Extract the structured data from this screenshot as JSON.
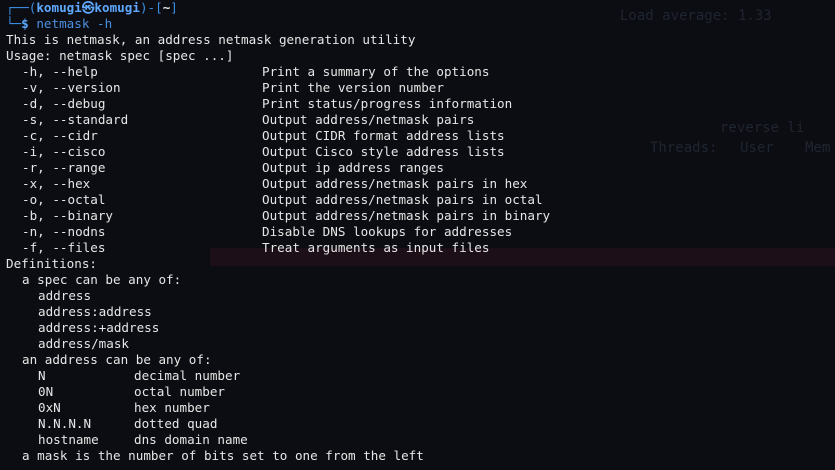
{
  "prompt": {
    "corner_top": "┌──(",
    "user": "komugi㉿komugi",
    "mid": ")-[",
    "dir": "~",
    "end": "]",
    "corner_bottom": "└─",
    "dollar": "$",
    "command": " netmask -h"
  },
  "intro": "This is netmask, an address netmask generation utility",
  "usage": "Usage: netmask spec [spec ...]",
  "options": [
    {
      "flag": "-h, --help",
      "desc": "Print a summary of the options"
    },
    {
      "flag": "-v, --version",
      "desc": "Print the version number"
    },
    {
      "flag": "-d, --debug",
      "desc": "Print status/progress information"
    },
    {
      "flag": "-s, --standard",
      "desc": "Output address/netmask pairs"
    },
    {
      "flag": "-c, --cidr",
      "desc": "Output CIDR format address lists"
    },
    {
      "flag": "-i, --cisco",
      "desc": "Output Cisco style address lists"
    },
    {
      "flag": "-r, --range",
      "desc": "Output ip address ranges"
    },
    {
      "flag": "-x, --hex",
      "desc": "Output address/netmask pairs in hex"
    },
    {
      "flag": "-o, --octal",
      "desc": "Output address/netmask pairs in octal"
    },
    {
      "flag": "-b, --binary",
      "desc": "Output address/netmask pairs in binary"
    },
    {
      "flag": "-n, --nodns",
      "desc": "Disable DNS lookups for addresses"
    },
    {
      "flag": "-f, --files",
      "desc": "Treat arguments as input files"
    }
  ],
  "definitions_heading": "Definitions:",
  "spec_heading": "a spec can be any of:",
  "spec_forms": [
    "address",
    "address:address",
    "address:+address",
    "address/mask"
  ],
  "address_heading": "an address can be any of:",
  "address_forms": [
    {
      "form": "N",
      "desc": "decimal number"
    },
    {
      "form": "0N",
      "desc": "octal number"
    },
    {
      "form": "0xN",
      "desc": "hex number"
    },
    {
      "form": "N.N.N.N",
      "desc": "dotted quad"
    },
    {
      "form": "hostname",
      "desc": "dns domain name"
    }
  ],
  "mask_line": "a mask is the number of bits set to one from the left",
  "background_text": {
    "load_avg": "Load average: 1.33",
    "threads": "Threads:",
    "user_col": "User",
    "mem_col": "Mem",
    "reverse": "reverse li"
  },
  "colors": {
    "background": "#0c0d13",
    "text": "#e6e6e6",
    "prompt_blue": "#3d8ee0"
  }
}
